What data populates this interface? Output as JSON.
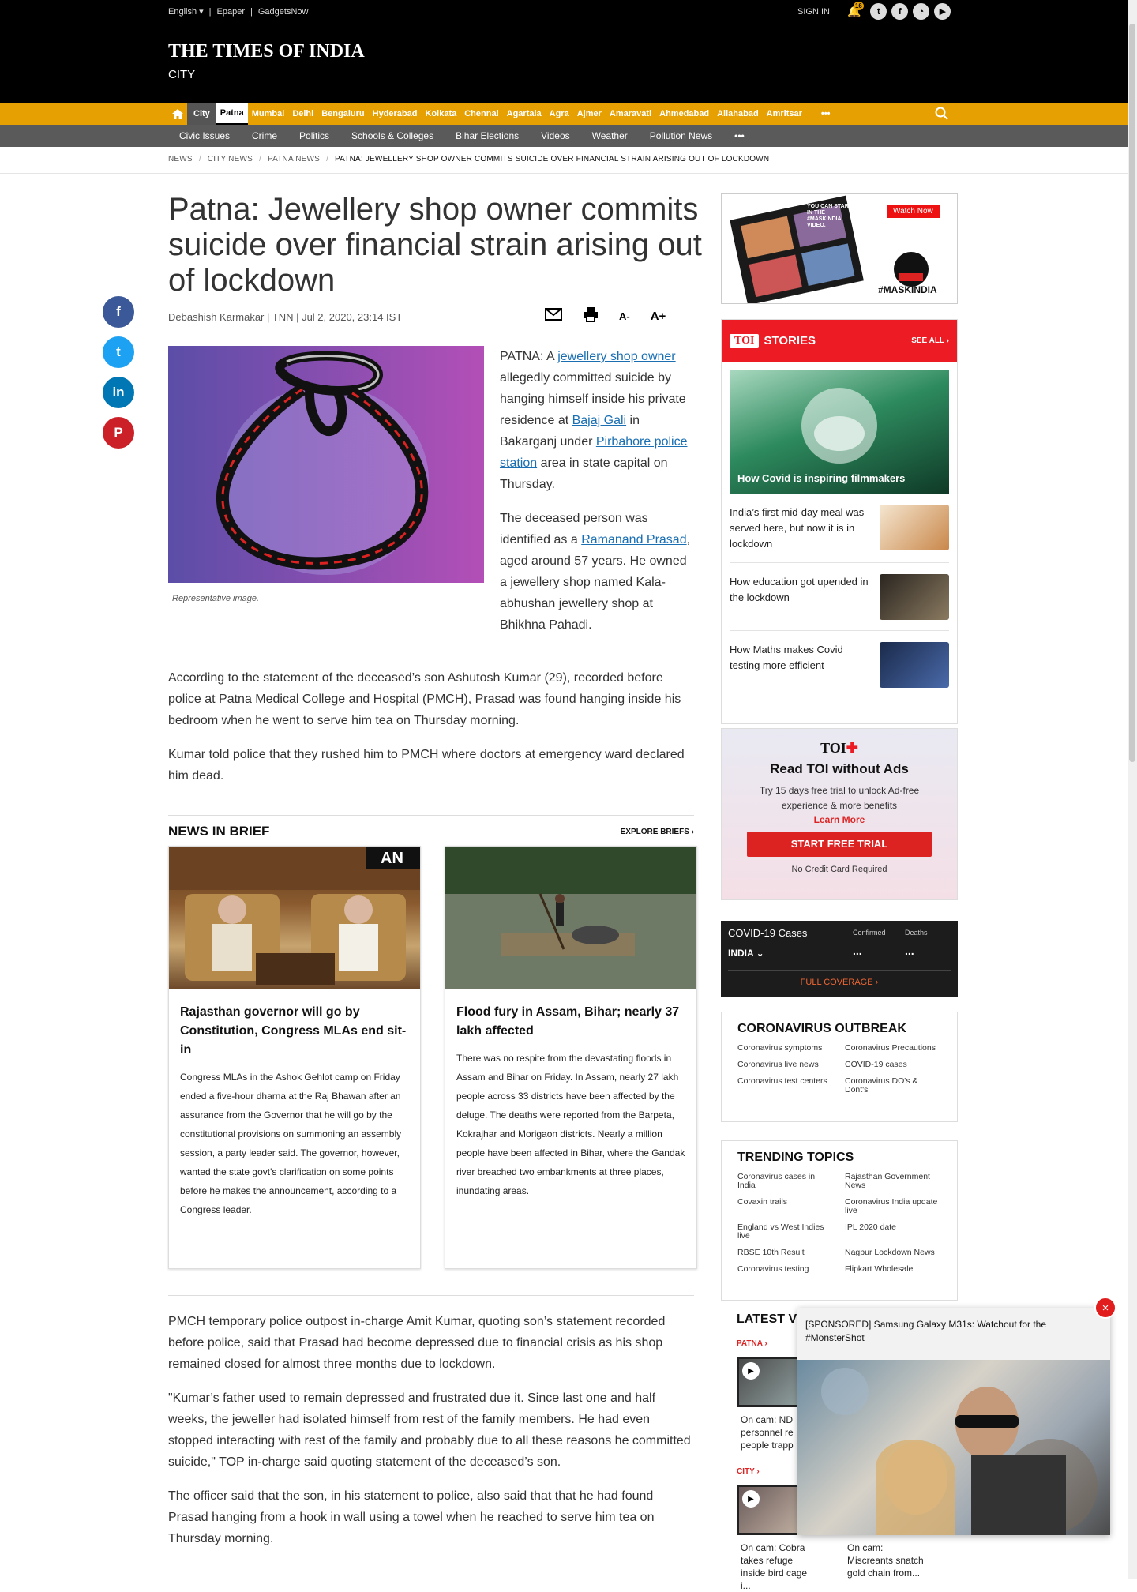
{
  "topbar": {
    "language": "English",
    "links": [
      "Epaper",
      "GadgetsNow"
    ],
    "signin": "SIGN IN",
    "notif_count": "16"
  },
  "masthead": {
    "logo": "THE TIMES OF INDIA",
    "section": "CITY"
  },
  "nav_cities": {
    "city_label": "City",
    "active": "Patna",
    "items": [
      "Mumbai",
      "Delhi",
      "Bengaluru",
      "Hyderabad",
      "Kolkata",
      "Chennai",
      "Agartala",
      "Agra",
      "Ajmer",
      "Amaravati",
      "Ahmedabad",
      "Allahabad",
      "Amritsar"
    ],
    "more": "•••"
  },
  "nav_topics": {
    "items": [
      "Civic Issues",
      "Crime",
      "Politics",
      "Schools & Colleges",
      "Bihar Elections",
      "Videos",
      "Weather",
      "Pollution News"
    ],
    "more": "•••"
  },
  "breadcrumb": [
    "NEWS",
    "CITY NEWS",
    "PATNA NEWS",
    "PATNA: JEWELLERY SHOP OWNER COMMITS SUICIDE OVER FINANCIAL STRAIN ARISING OUT OF LOCKDOWN"
  ],
  "article": {
    "headline": "Patna: Jewellery shop owner commits suicide over financial strain arising out of lockdown",
    "byline": "Debashish Karmakar | TNN | Jul 2, 2020, 23:14 IST",
    "tools": {
      "decrease": "A-",
      "increase": "A+"
    },
    "caption": "Representative image.",
    "p1": {
      "a": "PATNA: A ",
      "link1": "jewellery shop owner",
      "b": " allegedly committed suicide by hanging himself inside his private residence at ",
      "link2": "Bajaj Gali",
      "c": " in Bakarganj under ",
      "link3": "Pirbahore police station",
      "d": " area in state capital on Thursday."
    },
    "p2": {
      "a": "The deceased person was identified as a ",
      "link": "Ramanand Prasad",
      "b": ", aged around 57 years. He owned a jewellery shop named Kala-abhushan jewellery shop at Bhikhna Pahadi."
    },
    "p3": "According to the statement of the deceased’s son Ashutosh Kumar (29), recorded before police at Patna Medical College and Hospital (PMCH), Prasad was found hanging inside his bedroom when he went to serve him tea on Thursday morning.",
    "p4": "Kumar told police that they rushed him to PMCH where doctors at emergency ward declared him dead.",
    "p5": "PMCH temporary police outpost in-charge Amit Kumar, quoting son’s statement recorded before police, said that Prasad had become depressed due to financial crisis as his shop remained closed for almost three months due to lockdown.",
    "p6": "\"Kumar’s father used to remain depressed and frustrated due it. Since last one and half weeks, the jeweller had isolated himself from rest of the family members. He had even stopped interacting with rest of the family and probably due to all these reasons he committed suicide,\" TOP in-charge said quoting statement of the deceased’s son.",
    "p7": "The officer said that the son, in his statement to police, also said that that he had found Prasad hanging from a hook in wall using a towel when he reached to serve him tea on Thursday morning."
  },
  "news_in_brief": {
    "title": "NEWS IN BRIEF",
    "explore": "EXPLORE BRIEFS",
    "cards": [
      {
        "title": "Rajasthan governor will go by Constitution, Congress MLAs end sit-in",
        "body": "Congress MLAs in the Ashok Gehlot camp on Friday ended a five-hour dharna at the Raj Bhawan after an assurance from the Governor that he will go by the constitutional provisions on summoning an assembly session, a party leader said. The governor, however, wanted the state govt's clarification on some points before he makes the announcement, according to a Congress leader.",
        "badge": "AN"
      },
      {
        "title": "Flood fury in Assam, Bihar; nearly 37 lakh affected",
        "body": "There was no respite from the devastating floods in Assam and Bihar on Friday. In Assam, nearly 27 lakh people across 33 districts have been affected by the deluge. The deaths were reported from the Barpeta, Kokrajhar and Morigaon districts. Nearly a million people have been affected in Bihar, where the Gandak river breached two embankments at three places, inundating areas."
      }
    ]
  },
  "sidebar": {
    "ad": {
      "text1": "YOU CAN STAR IN THE #MASKINDIA VIDEO.",
      "button": "Watch Now",
      "tag": "#MASKINDIA"
    },
    "stories": {
      "brand": "TOI",
      "title": "STORIES",
      "see_all": "SEE ALL",
      "main": "How Covid is inspiring filmmakers",
      "items": [
        "India’s first mid-day meal was served here, but now it is in lockdown",
        "How education got upended in the lockdown",
        "How Maths makes Covid testing more efficient"
      ]
    },
    "toi_ad": {
      "brand": "TOI",
      "title": "Read TOI without Ads",
      "desc": "Try 15 days free trial to unlock Ad-free experience & more benefits",
      "learn": "Learn More",
      "cta": "START FREE TRIAL",
      "note": "No Credit Card Required"
    },
    "covid": {
      "title": "COVID-19 Cases",
      "region": "INDIA",
      "col1": "Confirmed",
      "col2": "Deaths",
      "v1": "...",
      "v2": "...",
      "link": "FULL COVERAGE"
    },
    "outbreak": {
      "title": "CORONAVIRUS OUTBREAK",
      "items": [
        "Coronavirus symptoms",
        "Coronavirus Precautions",
        "Coronavirus live news",
        "COVID-19 cases",
        "Coronavirus test centers",
        "Coronavirus DO's & Dont's"
      ]
    },
    "trending": {
      "title": "TRENDING TOPICS",
      "items": [
        "Coronavirus cases in India",
        "Rajasthan Government News",
        "Covaxin trails",
        "Coronavirus India update live",
        "England vs West Indies live",
        "IPL 2020 date",
        "RBSE 10th Result",
        "Nagpur Lockdown News",
        "Coronavirus testing",
        "Flipkart Wholesale"
      ]
    },
    "latest": {
      "title": "LATEST V",
      "tag1": "PATNA",
      "tag2": "CITY",
      "v1": "On cam: ND personnel re people trapp",
      "v2": "On cam: Cobra takes refuge inside bird cage i...",
      "v3": "On cam: Miscreants snatch gold chain from..."
    }
  },
  "popup": {
    "text": "[SPONSORED] Samsung Galaxy M31s: Watchout for the #MonsterShot",
    "close": "×"
  },
  "colors": {
    "accent": "#e6a001",
    "red": "#ed1c24",
    "link": "#1a6fb3"
  }
}
